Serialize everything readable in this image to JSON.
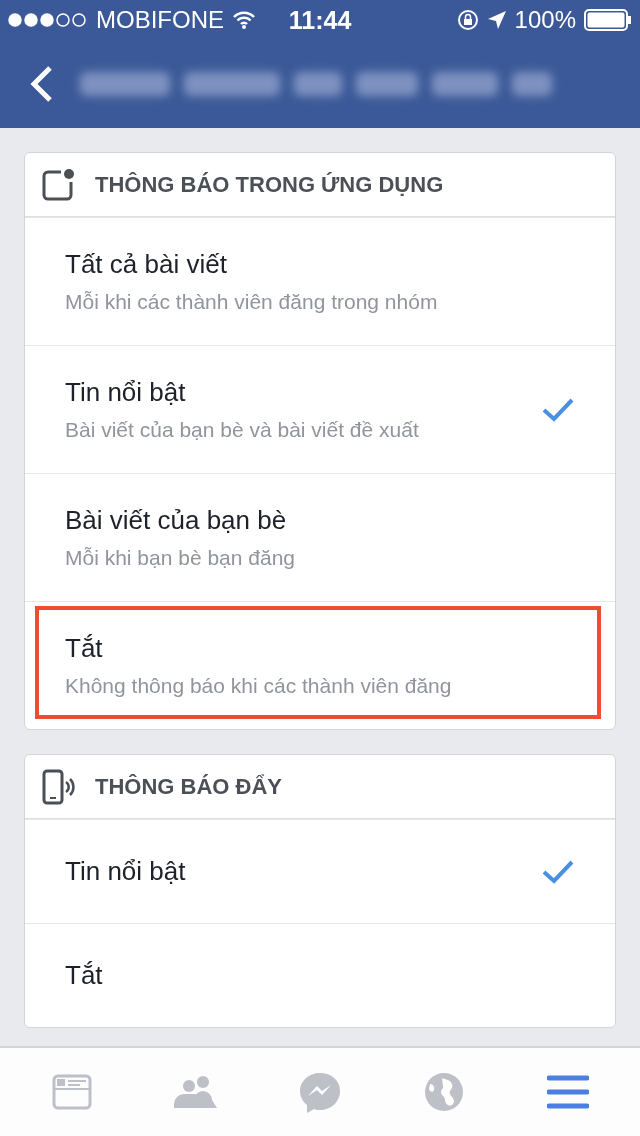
{
  "status_bar": {
    "carrier": "MOBIFONE",
    "time": "11:44",
    "battery": "100%"
  },
  "sections": [
    {
      "title": "THÔNG BÁO TRONG ỨNG DỤNG",
      "kind": "app",
      "options": [
        {
          "label": "Tất cả bài viết",
          "description": "Mỗi khi các thành viên đăng trong nhóm",
          "selected": false,
          "highlighted": false
        },
        {
          "label": "Tin nổi bật",
          "description": "Bài viết của bạn bè và bài viết đề xuất",
          "selected": true,
          "highlighted": false
        },
        {
          "label": "Bài viết của bạn bè",
          "description": "Mỗi khi bạn bè bạn đăng",
          "selected": false,
          "highlighted": false
        },
        {
          "label": "Tắt",
          "description": "Không thông báo khi các thành viên đăng",
          "selected": false,
          "highlighted": true
        }
      ]
    },
    {
      "title": "THÔNG BÁO ĐẨY",
      "kind": "push",
      "options": [
        {
          "label": "Tin nổi bật",
          "selected": true,
          "highlighted": false
        },
        {
          "label": "Tắt",
          "selected": false,
          "highlighted": false
        }
      ]
    }
  ],
  "tab_bar": [
    {
      "kind": "feed",
      "selected": false
    },
    {
      "kind": "friends",
      "selected": false
    },
    {
      "kind": "messenger",
      "selected": false
    },
    {
      "kind": "globe",
      "selected": false
    },
    {
      "kind": "menu",
      "selected": true
    }
  ]
}
